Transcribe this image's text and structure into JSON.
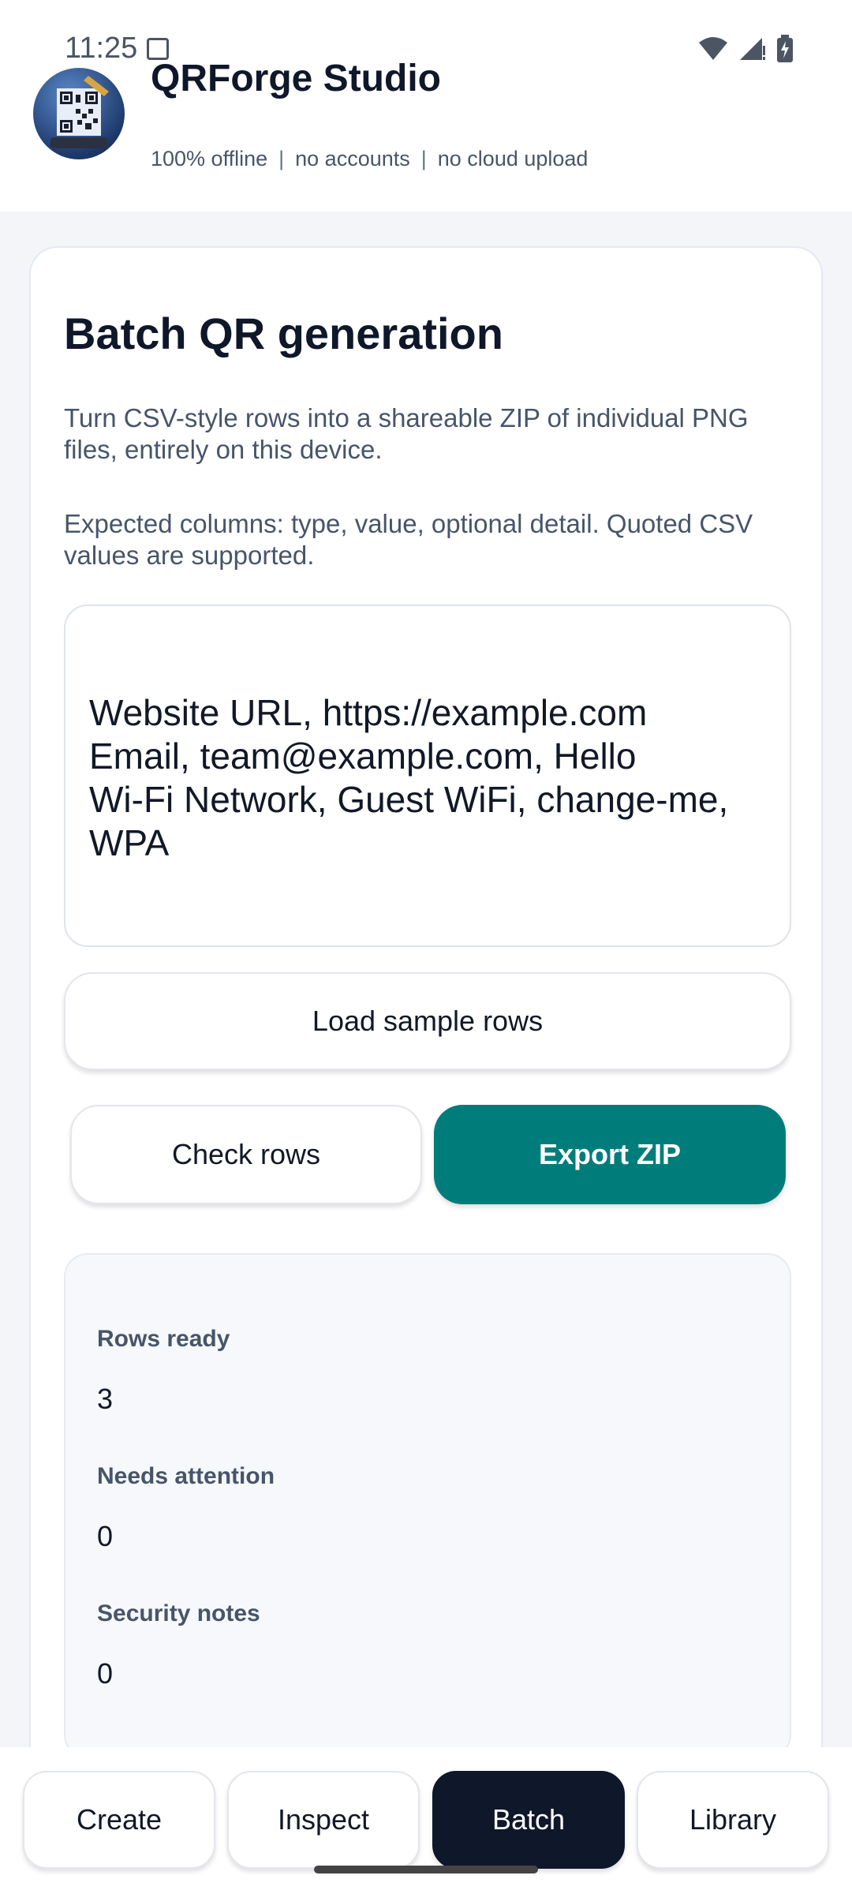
{
  "status_bar": {
    "time": "11:25"
  },
  "header": {
    "title": "QRForge Studio",
    "subtitle": [
      "100% offline",
      "no accounts",
      "no cloud upload"
    ],
    "separator": "|"
  },
  "batch": {
    "title": "Batch QR generation",
    "description": "Turn CSV-style rows into a shareable ZIP of individual PNG files, entirely on this device.",
    "columns_hint": "Expected columns: type, value, optional detail. Quoted CSV values are supported.",
    "rows_value": "Website URL, https://example.com\nEmail, team@example.com, Hello\nWi-Fi Network, Guest WiFi, change-me, WPA",
    "load_sample_label": "Load sample rows",
    "check_rows_label": "Check rows",
    "export_zip_label": "Export ZIP"
  },
  "stats": {
    "rows_ready_label": "Rows ready",
    "rows_ready_value": "3",
    "needs_attention_label": "Needs attention",
    "needs_attention_value": "0",
    "security_notes_label": "Security notes",
    "security_notes_value": "0"
  },
  "nav": {
    "tabs": [
      "Create",
      "Inspect",
      "Batch",
      "Library"
    ],
    "active": "Batch"
  },
  "colors": {
    "accent": "#007d7b",
    "active_tab": "#0f172a",
    "background": "#f3f5f9"
  },
  "icons": {
    "status": [
      "screenshot-icon",
      "wifi-icon",
      "signal-icon",
      "battery-charging-icon"
    ],
    "logo": "qr-logo-icon"
  }
}
